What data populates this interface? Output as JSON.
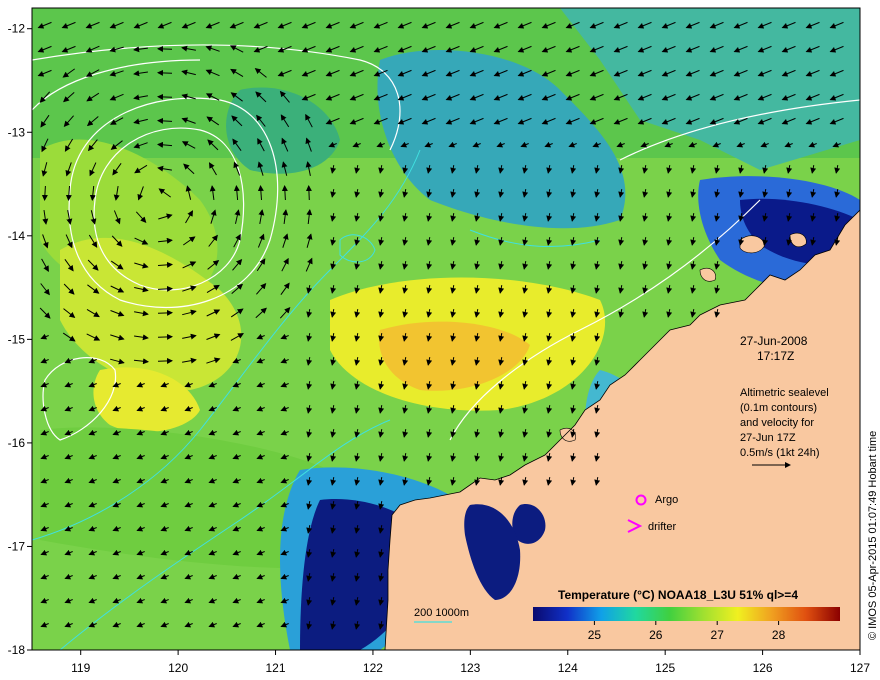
{
  "map": {
    "lon_ticks": [
      "119",
      "120",
      "121",
      "122",
      "123",
      "124",
      "125",
      "126",
      "127"
    ],
    "lat_ticks": [
      "-12",
      "-13",
      "-14",
      "-15",
      "-16",
      "-17",
      "-18"
    ],
    "lon_range": [
      118.5,
      127
    ],
    "lat_range": [
      -18,
      -11.8
    ]
  },
  "annotations": {
    "date": "27-Jun-2008",
    "time": "17:17Z",
    "desc_line1": "Altimetric sealevel",
    "desc_line2": "(0.1m contours)",
    "desc_line3": "and velocity for",
    "desc_line4": "27-Jun 17Z",
    "scale_label": "0.5m/s (1kt 24h)",
    "argo_label": "Argo",
    "drifter_label": "drifter",
    "depth_legend": "200  1000m",
    "credit": "© IMOS 05-Apr-2015 01:07:49 Hobart time"
  },
  "colorbar": {
    "title": "Temperature (°C) NOAA18_L3U 51% ql>=4",
    "ticks": [
      "25",
      "26",
      "27",
      "28"
    ],
    "tick_values": [
      25,
      26,
      27,
      28
    ],
    "range": [
      24,
      29
    ],
    "colors": [
      "#0a0a6e",
      "#1030c8",
      "#10a0e8",
      "#20d8a0",
      "#40d040",
      "#a0e030",
      "#f0f020",
      "#f0a020",
      "#e05010",
      "#8b0000"
    ]
  },
  "colors": {
    "land": "#f9c8a0",
    "ocean_mid": "#7ad24a",
    "contour": "#ffffff",
    "isobath": "#40e0e0",
    "marker": "#ff00ff"
  }
}
